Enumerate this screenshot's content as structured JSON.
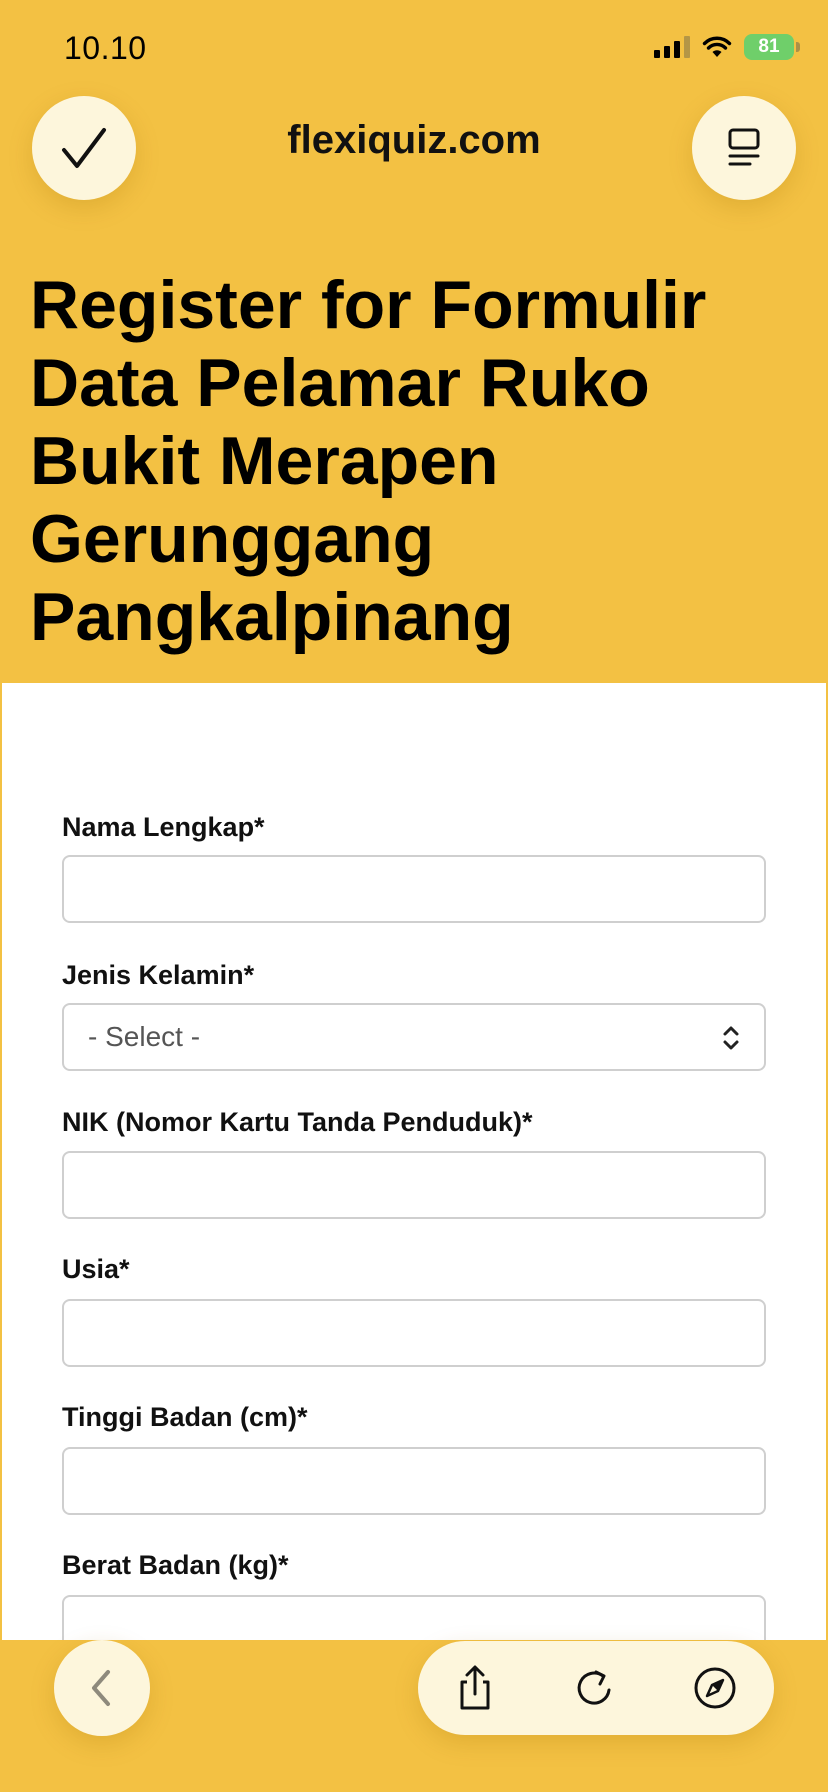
{
  "status_bar": {
    "time": "10.10",
    "battery": "81"
  },
  "header": {
    "site": "flexiquiz.com",
    "left_icon": "checkmark-icon",
    "right_icon": "menu-icon"
  },
  "page": {
    "heading": "Register for Formulir Data Pelamar Ruko Bukit Merapen Gerunggang Pangkalpinang"
  },
  "form": {
    "fields": [
      {
        "label": "Nama Lengkap*",
        "value": ""
      },
      {
        "label": "Jenis Kelamin*",
        "selected": "- Select -"
      },
      {
        "label": "NIK (Nomor Kartu Tanda Penduduk)*",
        "value": ""
      },
      {
        "label": "Usia*",
        "value": ""
      },
      {
        "label": "Tinggi Badan (cm)*",
        "value": ""
      },
      {
        "label": "Berat Badan (kg)*",
        "value": ""
      }
    ]
  },
  "toolbar": {
    "icons": [
      "back-icon",
      "share-icon",
      "reload-icon",
      "compass-icon"
    ]
  },
  "colors": {
    "brand_yellow": "#f3c143",
    "button_cream": "#fdf6dc",
    "battery_green": "#6fcf6a"
  }
}
